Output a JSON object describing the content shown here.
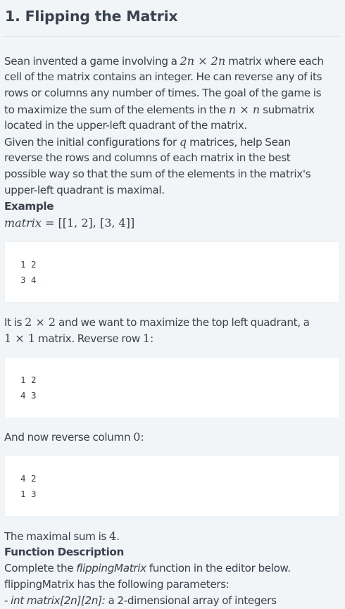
{
  "title": "1. Flipping the Matrix",
  "intro": {
    "l1_a": "Sean invented a game involving a ",
    "l1_m1": "2n",
    "l1_x": " × ",
    "l1_m2": "2n",
    "l1_b": " matrix where each",
    "l2": "cell of the matrix contains an integer. He can reverse any of its",
    "l3": "rows or columns any number of times. The goal of the game is",
    "l4_a": "to maximize the sum of the elements in the ",
    "l4_m1": "n",
    "l4_x": " × ",
    "l4_m2": "n",
    "l4_b": " submatrix",
    "l5": "located in the upper-left quadrant of the matrix.",
    "l6_a": "Given the initial configurations for ",
    "l6_m": "q",
    "l6_b": " matrices, help Sean",
    "l7": "reverse the rows and columns of each matrix in the best",
    "l8": "possible way so that the sum of the elements in the matrix's",
    "l9": "upper-left quadrant is maximal.",
    "example_heading": "Example",
    "example_var": "matrix",
    "example_eq": " = [[1, 2], [3, 4]]"
  },
  "code1": [
    "1 2",
    "3 4"
  ],
  "step1": {
    "a": "It is ",
    "m1": "2 × 2",
    "b": " and we want to maximize the top left quadrant, a",
    "m2": "1 × 1",
    "c": " matrix. Reverse row ",
    "m3": "1",
    "d": ":"
  },
  "code2": [
    "1 2",
    "4 3"
  ],
  "step2": {
    "a": "And now reverse column ",
    "m": "0",
    "b": ":"
  },
  "code3": [
    "4 2",
    "1 3"
  ],
  "outro": {
    "a": "The maximal sum is ",
    "m": "4",
    "b": ".",
    "function_heading": "Function Description",
    "fd_a": "Complete the ",
    "fd_name": "flippingMatrix",
    "fd_b": " function in the editor below.",
    "params_intro": "flippingMatrix has the following parameters:",
    "param_a": "- ",
    "param_name": "int matrix[2n][2n]:",
    "param_b": " a 2-dimensional array of integers"
  }
}
